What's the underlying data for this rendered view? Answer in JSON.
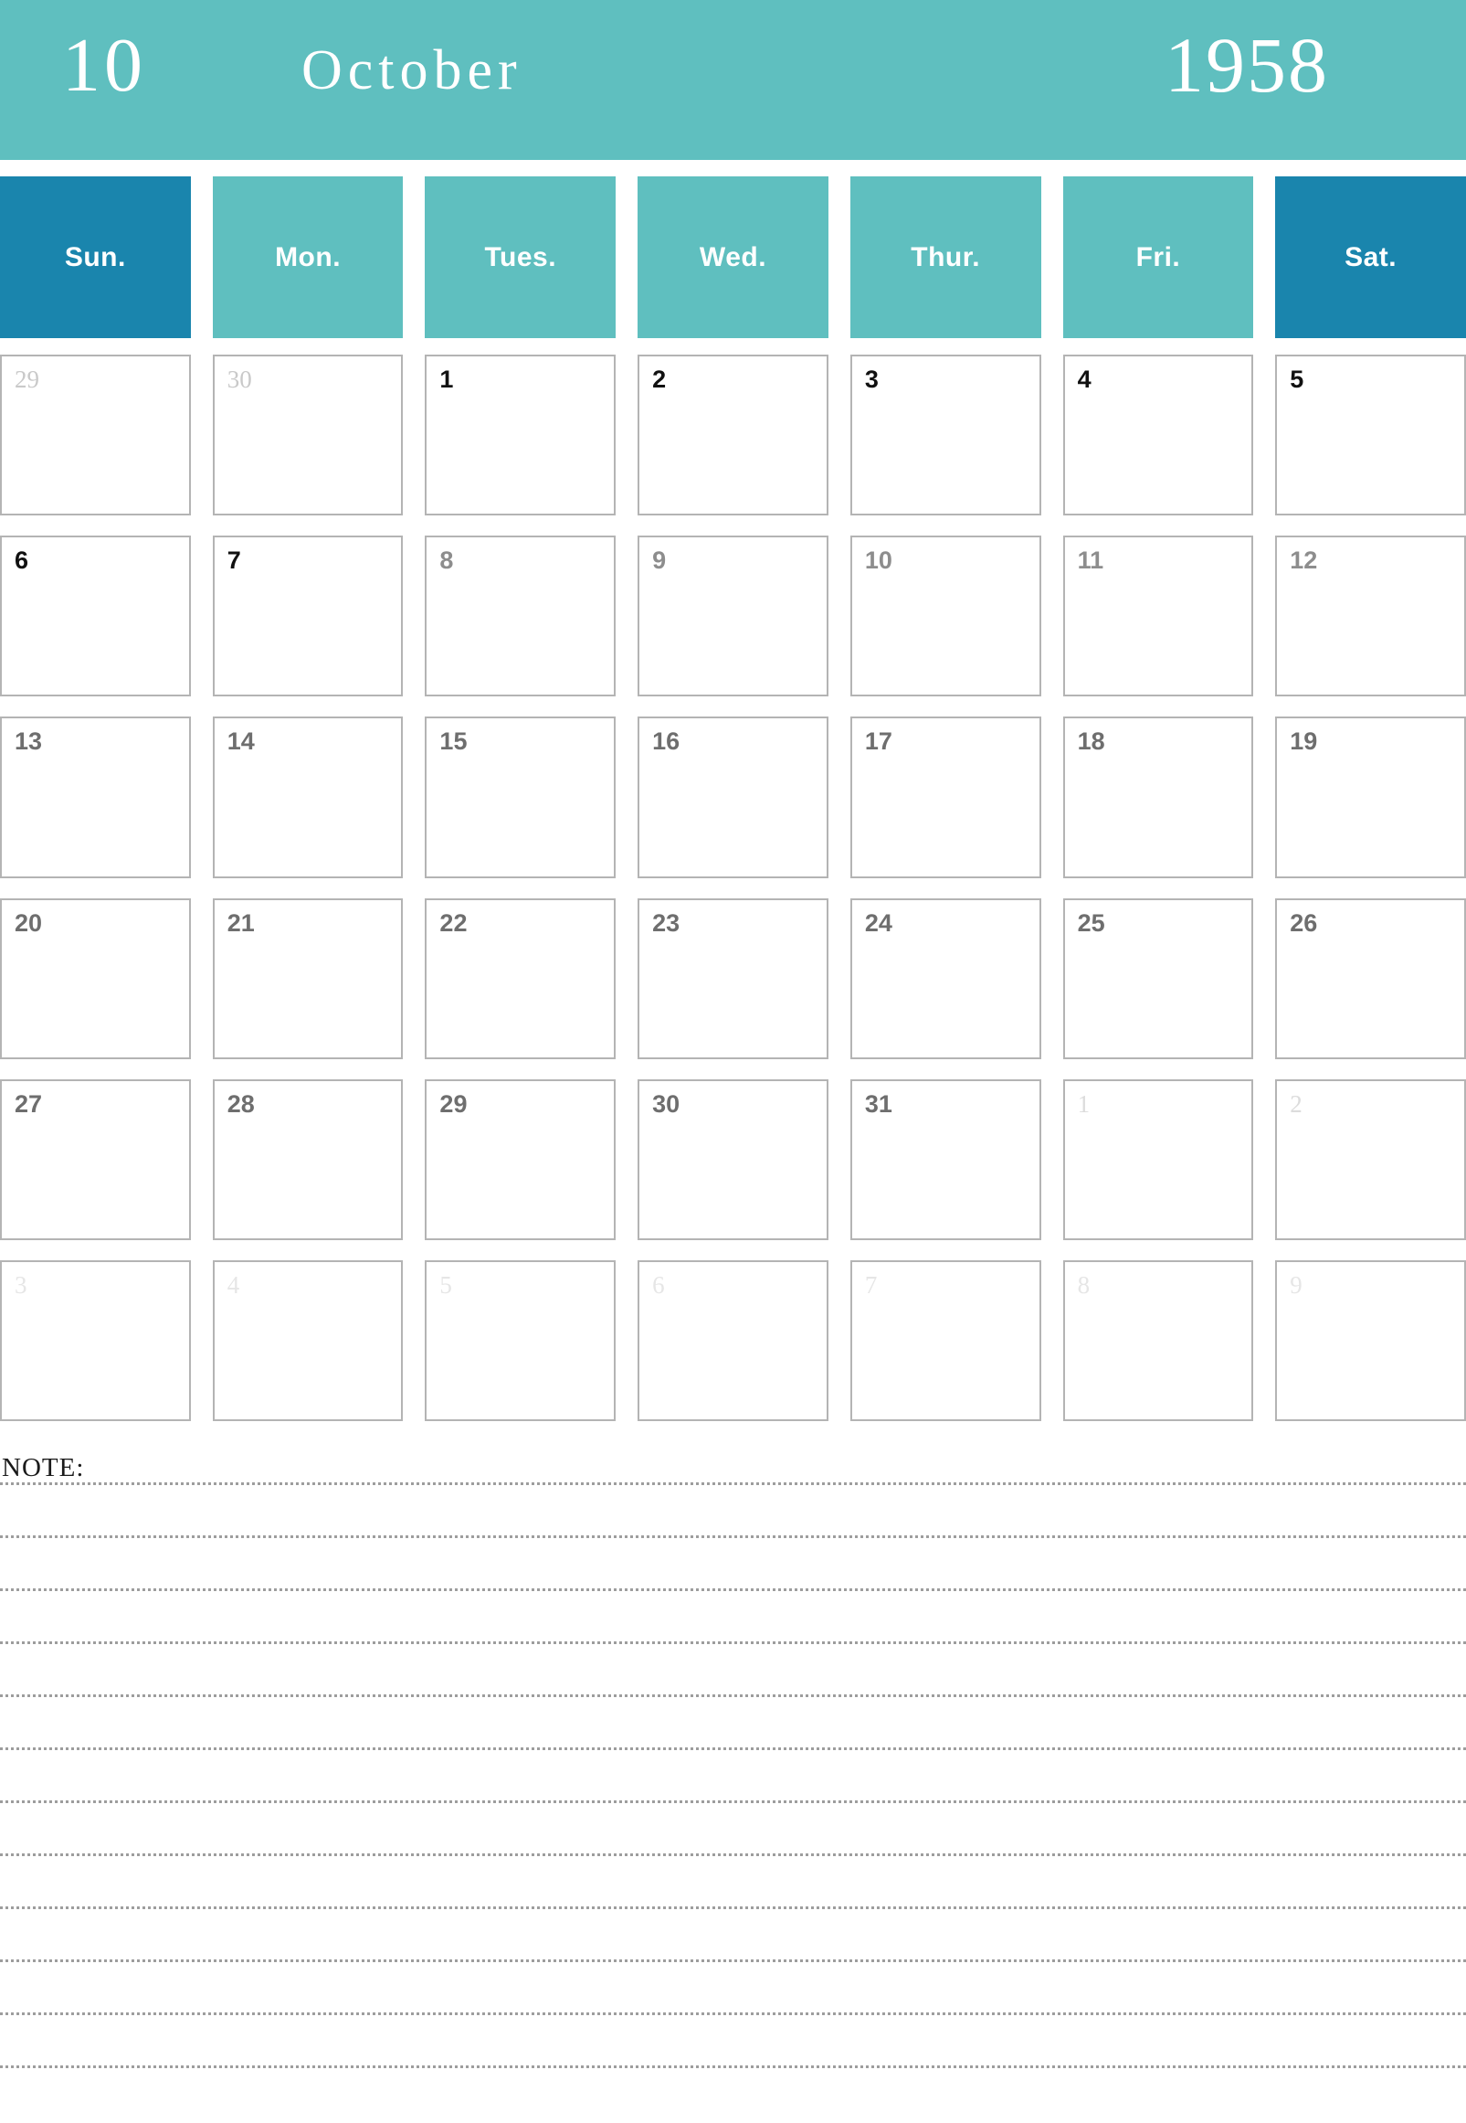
{
  "header": {
    "month_number": "10",
    "month_name": "October",
    "year": "1958",
    "banner_color": "#5FBFBF"
  },
  "weekdays": [
    {
      "label": "Sun.",
      "weekend": true,
      "color": "#1A85AD"
    },
    {
      "label": "Mon.",
      "weekend": false,
      "color": "#5FBFBF"
    },
    {
      "label": "Tues.",
      "weekend": false,
      "color": "#5FBFBF"
    },
    {
      "label": "Wed.",
      "weekend": false,
      "color": "#5FBFBF"
    },
    {
      "label": "Thur.",
      "weekend": false,
      "color": "#5FBFBF"
    },
    {
      "label": "Fri.",
      "weekend": false,
      "color": "#5FBFBF"
    },
    {
      "label": "Sat.",
      "weekend": true,
      "color": "#1A85AD"
    }
  ],
  "calendar": {
    "month": "October",
    "year": 1958,
    "first_day_of_week": "Wednesday",
    "days_in_month": 31,
    "weeks": [
      [
        {
          "day": "29",
          "tone": "light"
        },
        {
          "day": "30",
          "tone": "light"
        },
        {
          "day": "1",
          "tone": "black"
        },
        {
          "day": "2",
          "tone": "black"
        },
        {
          "day": "3",
          "tone": "black"
        },
        {
          "day": "4",
          "tone": "black"
        },
        {
          "day": "5",
          "tone": "black"
        }
      ],
      [
        {
          "day": "6",
          "tone": "black"
        },
        {
          "day": "7",
          "tone": "black"
        },
        {
          "day": "8",
          "tone": "mid"
        },
        {
          "day": "9",
          "tone": "mid"
        },
        {
          "day": "10",
          "tone": "mid"
        },
        {
          "day": "11",
          "tone": "mid"
        },
        {
          "day": "12",
          "tone": "mid"
        }
      ],
      [
        {
          "day": "13",
          "tone": "dark"
        },
        {
          "day": "14",
          "tone": "dark"
        },
        {
          "day": "15",
          "tone": "dark"
        },
        {
          "day": "16",
          "tone": "dark"
        },
        {
          "day": "17",
          "tone": "dark"
        },
        {
          "day": "18",
          "tone": "dark"
        },
        {
          "day": "19",
          "tone": "dark"
        }
      ],
      [
        {
          "day": "20",
          "tone": "dark"
        },
        {
          "day": "21",
          "tone": "dark"
        },
        {
          "day": "22",
          "tone": "dark"
        },
        {
          "day": "23",
          "tone": "dark"
        },
        {
          "day": "24",
          "tone": "dark"
        },
        {
          "day": "25",
          "tone": "dark"
        },
        {
          "day": "26",
          "tone": "dark"
        }
      ],
      [
        {
          "day": "27",
          "tone": "dark"
        },
        {
          "day": "28",
          "tone": "dark"
        },
        {
          "day": "29",
          "tone": "dark"
        },
        {
          "day": "30",
          "tone": "dark"
        },
        {
          "day": "31",
          "tone": "dark"
        },
        {
          "day": "1",
          "tone": "faint"
        },
        {
          "day": "2",
          "tone": "faint"
        }
      ],
      [
        {
          "day": "3",
          "tone": "vfaint"
        },
        {
          "day": "4",
          "tone": "vfaint"
        },
        {
          "day": "5",
          "tone": "vfaint"
        },
        {
          "day": "6",
          "tone": "vfaint"
        },
        {
          "day": "7",
          "tone": "vfaint"
        },
        {
          "day": "8",
          "tone": "vfaint"
        },
        {
          "day": "9",
          "tone": "vfaint"
        }
      ]
    ]
  },
  "note": {
    "label": "NOTE:",
    "line_count": 12
  }
}
